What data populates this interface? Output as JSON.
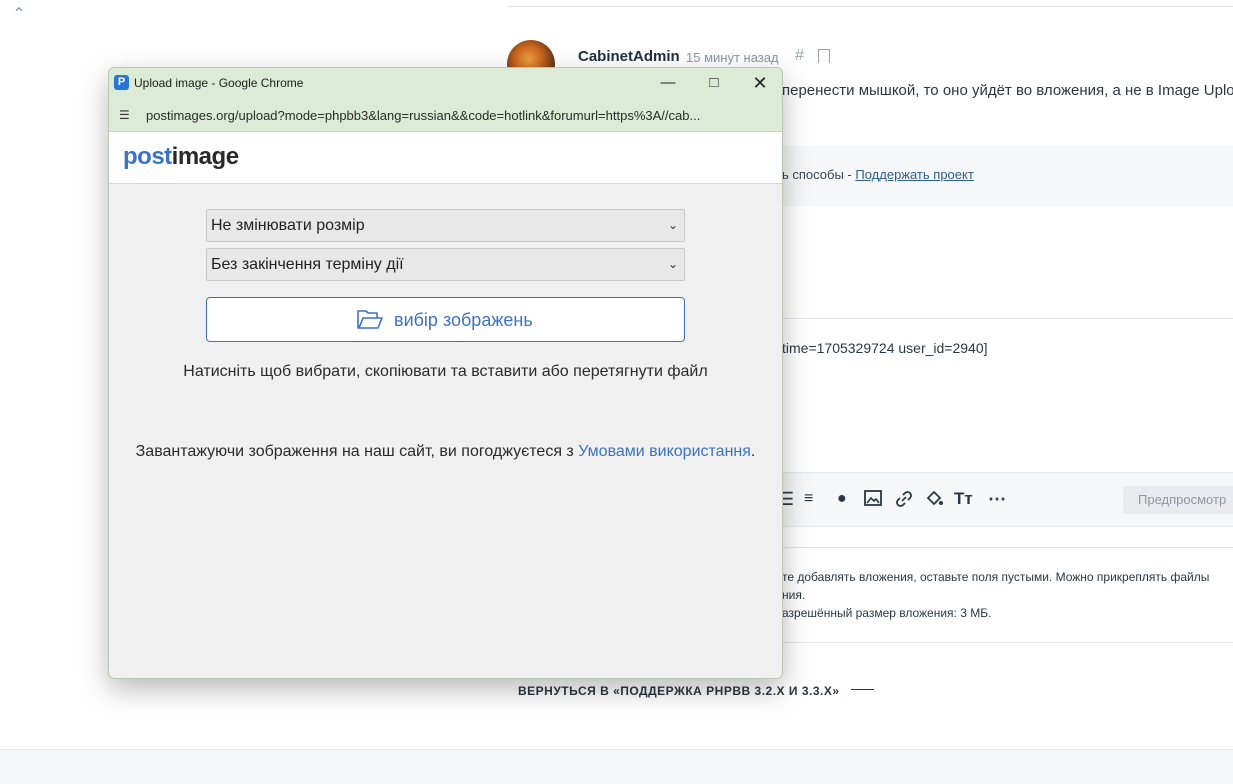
{
  "forum": {
    "author": "CabinetAdmin",
    "time": "15 минут назад",
    "hash": "#",
    "post_text": "перенести мышкой, то оно уйдёт во вложения, а не в Image Uploa",
    "sig_text": "ь способы - ",
    "sig_link": "Поддержать проект",
    "code_text": "time=1705329724 user_id=2940]",
    "preview_button": "Предпросмотр",
    "attachments": {
      "line1": "те добавлять вложения, оставьте поля пустыми. Можно прикреплять файлы",
      "line2": "ния.",
      "line3": "азрешённый размер вложения: 3 МБ."
    },
    "back_link": "ВЕРНУТЬСЯ В «ПОДДЕРЖКА PHPBB 3.2.X И 3.3.X»"
  },
  "popup": {
    "window_title": "Upload image - Google Chrome",
    "app_icon_letter": "P",
    "url": "postimages.org/upload?mode=phpbb3&lang=russian&&code=hotlink&forumurl=https%3A//cab...",
    "logo_part1": "post",
    "logo_part2": "image",
    "resize_select": "Не змінювати розмір",
    "expiry_select": "Без закінчення терміну дії",
    "choose_button": "вибір зображень",
    "hint": "Натисніть щоб вибрати, скопіювати та вставити або перетягнути файл",
    "terms_text": "Завантажуючи зображення на наш сайт, ви погоджуєтеся з ",
    "terms_link": "Умовами використання",
    "terms_end": "."
  },
  "icons": {
    "scroll_up": "chevron-up-icon",
    "toolbar": [
      "bullet-list-icon",
      "numbered-list-icon",
      "dot-icon",
      "image-icon",
      "link-icon",
      "color-fill-icon",
      "font-size-icon",
      "more-icon"
    ]
  }
}
